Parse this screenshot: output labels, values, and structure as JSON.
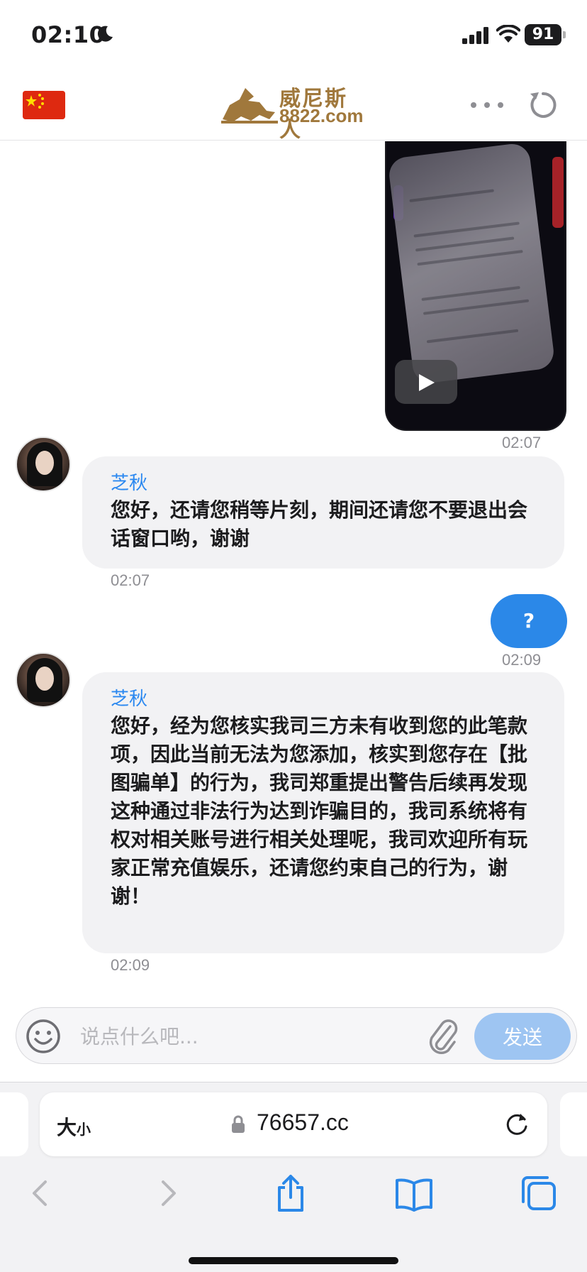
{
  "status_bar": {
    "time": "02:10",
    "battery": "91"
  },
  "header": {
    "logo_cn": "威尼斯人",
    "logo_en": "8822.com"
  },
  "chat": {
    "video_time": "02:07",
    "messages": [
      {
        "sender": "芝秋",
        "text": "您好，还请您稍等片刻，期间还请您不要退出会话窗口哟，谢谢",
        "time": "02:07"
      },
      {
        "outgoing_text": "?",
        "time": "02:09"
      },
      {
        "sender": "芝秋",
        "text": "您好，经为您核实我司三方未有收到您的此笔款项，因此当前无法为您添加，核实到您存在【批图骗单】的行为，我司郑重提出警告后续再发现这种通过非法行为达到诈骗目的，我司系统将有权对相关账号进行相关处理呢，我司欢迎所有玩家正常充值娱乐，还请您约束自己的行为，谢谢！",
        "time": "02:09"
      }
    ]
  },
  "composer": {
    "placeholder": "说点什么吧...",
    "send_label": "发送"
  },
  "safari": {
    "text_size_big": "大",
    "text_size_small": "小",
    "url": "76657.cc"
  },
  "colors": {
    "accent": "#2b88e8",
    "sender_name": "#2b88f0",
    "send_disabled": "#9ec5f2",
    "logo_gold": "#a0783c"
  }
}
